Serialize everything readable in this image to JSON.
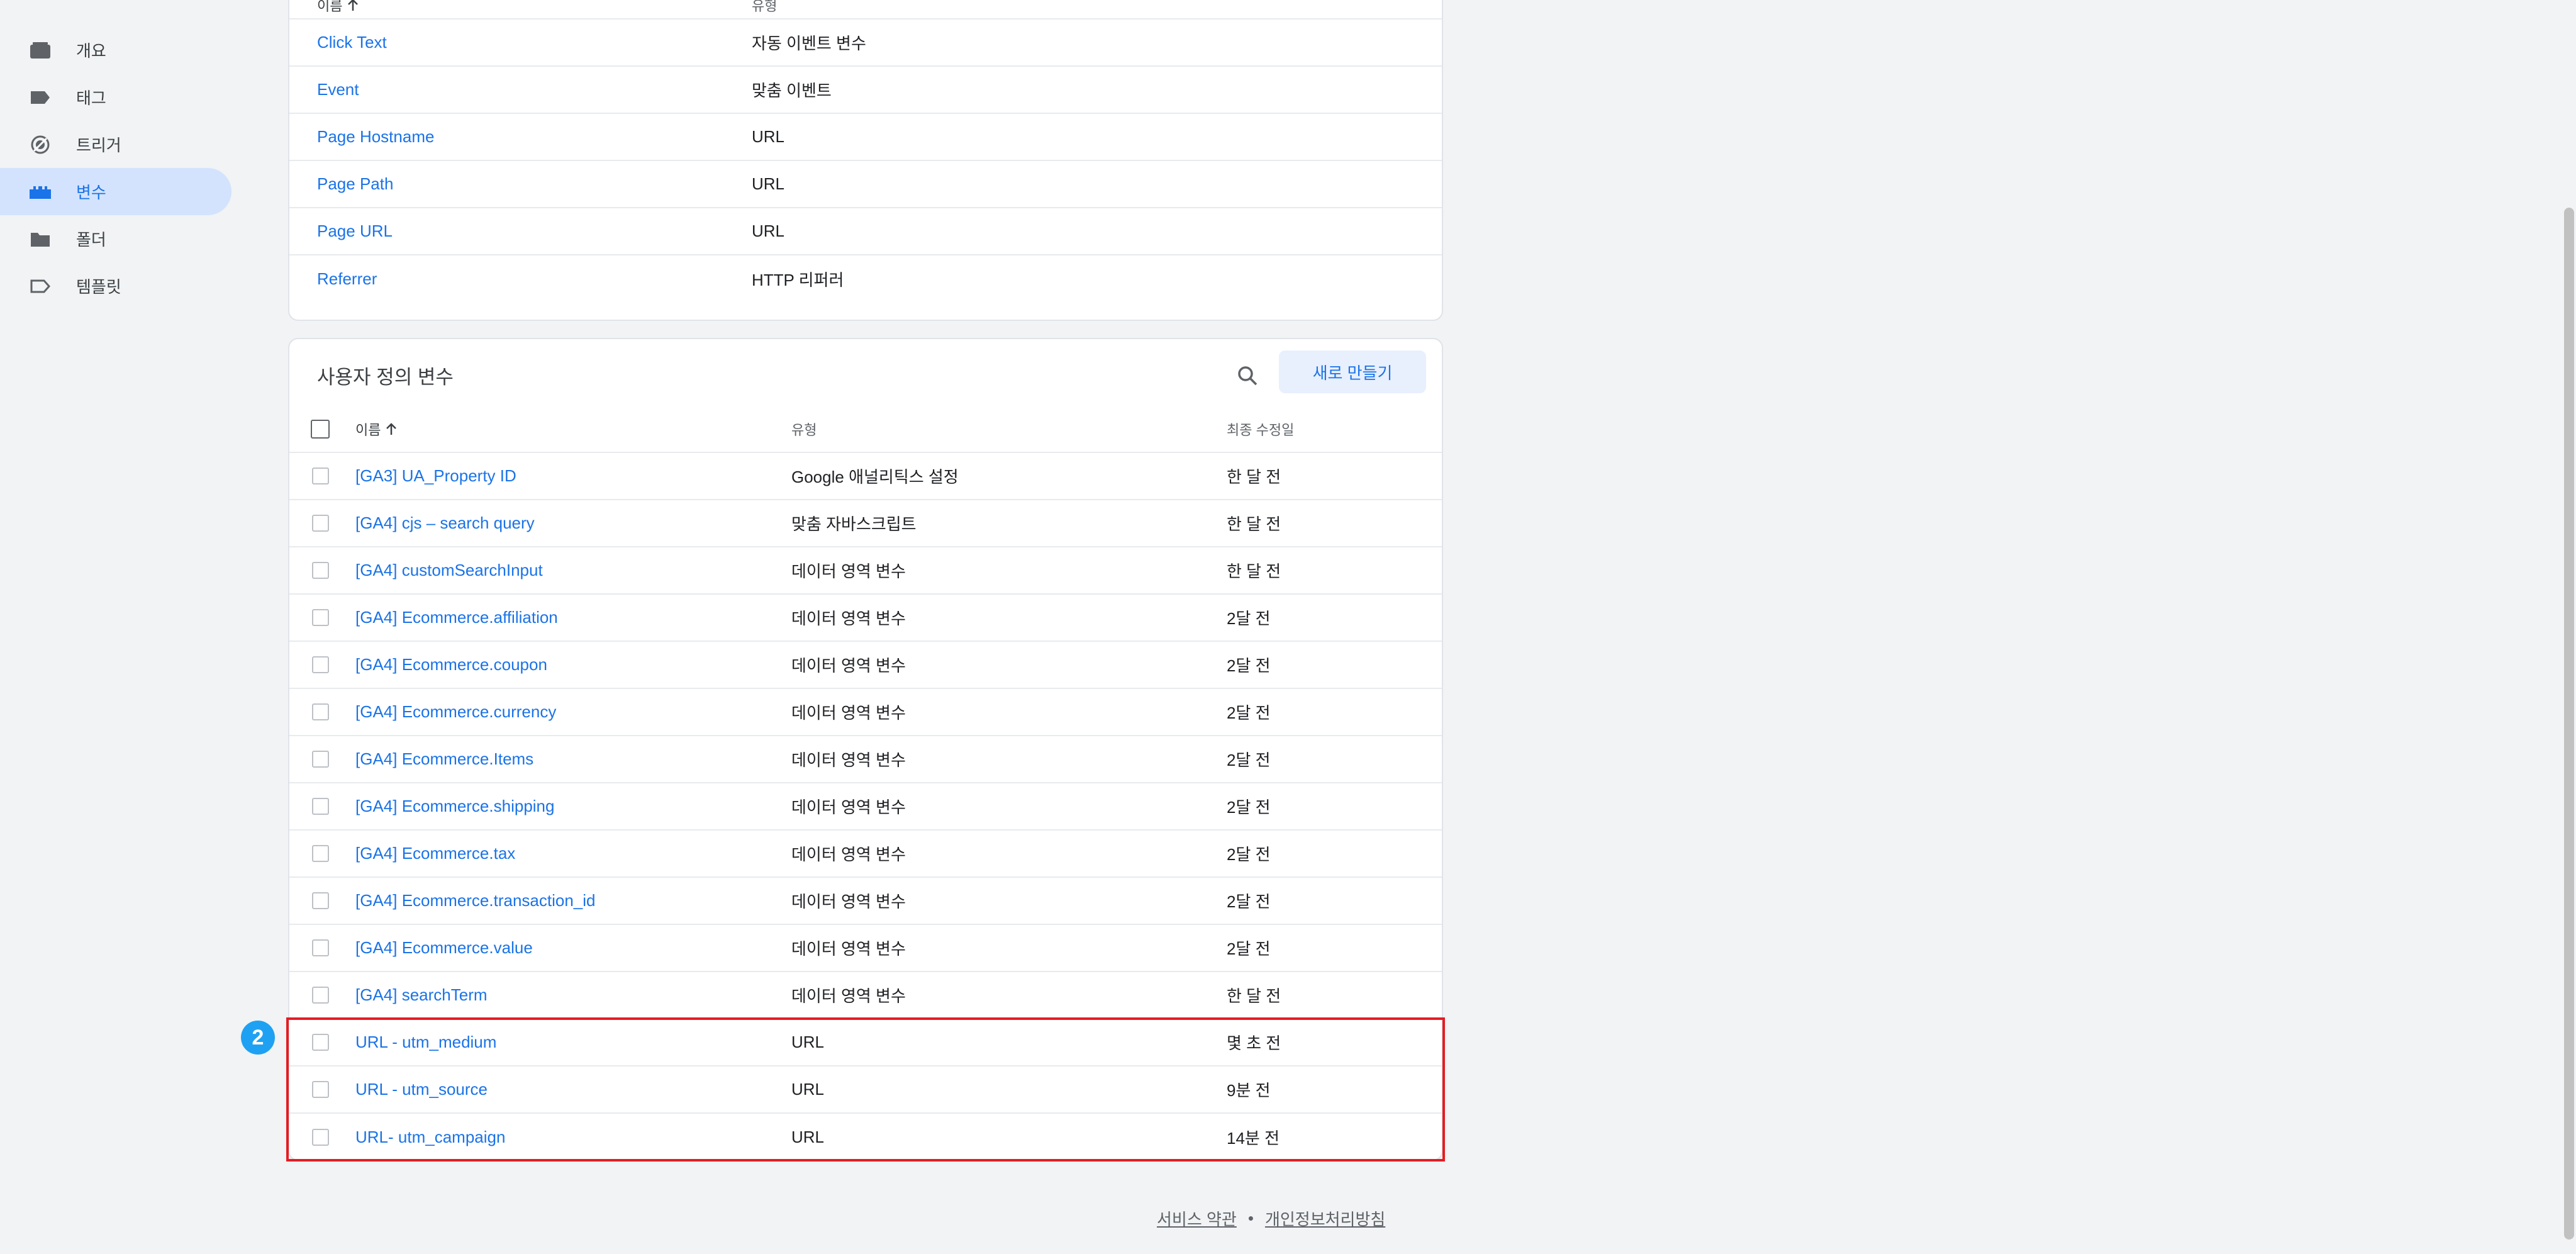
{
  "sidebar": {
    "items": [
      {
        "label": "개요",
        "icon": "overview-icon",
        "active": false
      },
      {
        "label": "태그",
        "icon": "tag-icon",
        "active": false
      },
      {
        "label": "트리거",
        "icon": "trigger-icon",
        "active": false
      },
      {
        "label": "변수",
        "icon": "variables-icon",
        "active": true
      },
      {
        "label": "폴더",
        "icon": "folder-icon",
        "active": false
      },
      {
        "label": "템플릿",
        "icon": "template-icon",
        "active": false
      }
    ]
  },
  "builtin": {
    "header": {
      "name": "이름",
      "sort_icon": "arrow-up-icon",
      "type": "유형"
    },
    "rows": [
      {
        "name": "Click Text",
        "type": "자동 이벤트 변수"
      },
      {
        "name": "Event",
        "type": "맞춤 이벤트"
      },
      {
        "name": "Page Hostname",
        "type": "URL"
      },
      {
        "name": "Page Path",
        "type": "URL"
      },
      {
        "name": "Page URL",
        "type": "URL"
      },
      {
        "name": "Referrer",
        "type": "HTTP 리퍼러"
      }
    ]
  },
  "user_defined": {
    "title": "사용자 정의 변수",
    "new_button": "새로 만들기",
    "header": {
      "name": "이름",
      "type": "유형",
      "modified": "최종 수정일"
    },
    "rows": [
      {
        "name": "[GA3] UA_Property ID",
        "type": "Google 애널리틱스 설정",
        "modified": "한 달 전"
      },
      {
        "name": "[GA4] cjs – search query",
        "type": "맞춤 자바스크립트",
        "modified": "한 달 전"
      },
      {
        "name": "[GA4] customSearchInput",
        "type": "데이터 영역 변수",
        "modified": "한 달 전"
      },
      {
        "name": "[GA4] Ecommerce.affiliation",
        "type": "데이터 영역 변수",
        "modified": "2달 전"
      },
      {
        "name": "[GA4] Ecommerce.coupon",
        "type": "데이터 영역 변수",
        "modified": "2달 전"
      },
      {
        "name": "[GA4] Ecommerce.currency",
        "type": "데이터 영역 변수",
        "modified": "2달 전"
      },
      {
        "name": "[GA4] Ecommerce.Items",
        "type": "데이터 영역 변수",
        "modified": "2달 전"
      },
      {
        "name": "[GA4] Ecommerce.shipping",
        "type": "데이터 영역 변수",
        "modified": "2달 전"
      },
      {
        "name": "[GA4] Ecommerce.tax",
        "type": "데이터 영역 변수",
        "modified": "2달 전"
      },
      {
        "name": "[GA4] Ecommerce.transaction_id",
        "type": "데이터 영역 변수",
        "modified": "2달 전"
      },
      {
        "name": "[GA4] Ecommerce.value",
        "type": "데이터 영역 변수",
        "modified": "2달 전"
      },
      {
        "name": "[GA4] searchTerm",
        "type": "데이터 영역 변수",
        "modified": "한 달 전"
      },
      {
        "name": "URL - utm_medium",
        "type": "URL",
        "modified": "몇 초 전"
      },
      {
        "name": "URL - utm_source",
        "type": "URL",
        "modified": "9분 전"
      },
      {
        "name": "URL- utm_campaign",
        "type": "URL",
        "modified": "14분 전"
      }
    ]
  },
  "annotation": {
    "step_number": "2",
    "highlight_color": "#e51c23",
    "badge_color": "#1ea1f2"
  },
  "footer": {
    "terms": "서비스 약관",
    "separator": "•",
    "privacy": "개인정보처리방침"
  },
  "colors": {
    "accent": "#1a73e8",
    "active_nav_bg": "#d3e3fd",
    "page_bg": "#f1f3f4"
  }
}
